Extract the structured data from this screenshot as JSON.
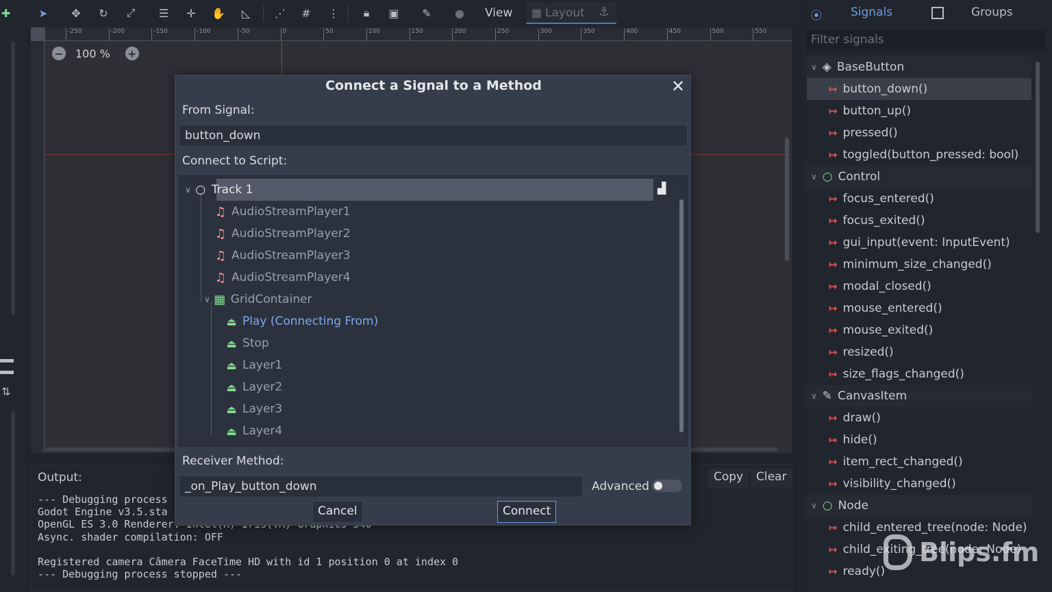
{
  "toolbar": {
    "view_label": "View",
    "layout_label": "Layout"
  },
  "viewport": {
    "zoom_label": "100 %",
    "ruler_ticks": [
      "-250",
      "-200",
      "-150",
      "-100",
      "-50",
      "0",
      "50",
      "100",
      "150",
      "200",
      "250",
      "300",
      "350",
      "400",
      "450",
      "500",
      "550"
    ]
  },
  "output": {
    "label": "Output:",
    "copy_label": "Copy",
    "clear_label": "Clear",
    "lines": [
      "--- Debugging process",
      "Godot Engine v3.5.sta",
      "OpenGL ES 3.0 Renderer: Intel(R) Iris(TM) Graphics 540",
      "Async. shader compilation: OFF",
      "",
      "Registered camera Câmera FaceTime HD with id 1 position 0 at index 0",
      "--- Debugging process stopped ---"
    ]
  },
  "dock": {
    "tab_signals": "Signals",
    "tab_groups": "Groups",
    "filter_placeholder": "Filter signals",
    "rows": [
      {
        "type": "section",
        "icon": "cube-icon",
        "label": "BaseButton"
      },
      {
        "type": "signal",
        "label": "button_down()",
        "selected": true
      },
      {
        "type": "signal",
        "label": "button_up()"
      },
      {
        "type": "signal",
        "label": "pressed()"
      },
      {
        "type": "signal",
        "label": "toggled(button_pressed: bool)"
      },
      {
        "type": "section",
        "icon": "circle-icon",
        "label": "Control"
      },
      {
        "type": "signal",
        "label": "focus_entered()"
      },
      {
        "type": "signal",
        "label": "focus_exited()"
      },
      {
        "type": "signal",
        "label": "gui_input(event: InputEvent)"
      },
      {
        "type": "signal",
        "label": "minimum_size_changed()"
      },
      {
        "type": "signal",
        "label": "modal_closed()"
      },
      {
        "type": "signal",
        "label": "mouse_entered()"
      },
      {
        "type": "signal",
        "label": "mouse_exited()"
      },
      {
        "type": "signal",
        "label": "resized()"
      },
      {
        "type": "signal",
        "label": "size_flags_changed()"
      },
      {
        "type": "section",
        "icon": "brush-icon",
        "label": "CanvasItem"
      },
      {
        "type": "signal",
        "label": "draw()"
      },
      {
        "type": "signal",
        "label": "hide()"
      },
      {
        "type": "signal",
        "label": "item_rect_changed()"
      },
      {
        "type": "signal",
        "label": "visibility_changed()"
      },
      {
        "type": "section",
        "icon": "circle-icon",
        "label": "Node"
      },
      {
        "type": "signal",
        "label": "child_entered_tree(node: Node)"
      },
      {
        "type": "signal",
        "label": "child_exiting_tree(node: Node)"
      },
      {
        "type": "signal",
        "label": "ready()"
      }
    ]
  },
  "dialog": {
    "title": "Connect a Signal to a Method",
    "from_signal_label": "From Signal:",
    "from_signal_value": "button_down",
    "connect_to_script_label": "Connect to Script:",
    "tree": [
      {
        "label": "Track 1",
        "icon": "node-circle-icon",
        "depth": 0,
        "root": true
      },
      {
        "label": "AudioStreamPlayer1",
        "icon": "audio-icon",
        "depth": 1
      },
      {
        "label": "AudioStreamPlayer2",
        "icon": "audio-icon",
        "depth": 1
      },
      {
        "label": "AudioStreamPlayer3",
        "icon": "audio-icon",
        "depth": 1
      },
      {
        "label": "AudioStreamPlayer4",
        "icon": "audio-icon",
        "depth": 1
      },
      {
        "label": "GridContainer",
        "icon": "grid-icon",
        "depth": 1,
        "expanded": true
      },
      {
        "label": "Play (Connecting From)",
        "icon": "button-icon",
        "depth": 2,
        "connecting": true
      },
      {
        "label": "Stop",
        "icon": "button-icon",
        "depth": 2
      },
      {
        "label": "Layer1",
        "icon": "button-icon",
        "depth": 2
      },
      {
        "label": "Layer2",
        "icon": "button-icon",
        "depth": 2
      },
      {
        "label": "Layer3",
        "icon": "button-icon",
        "depth": 2
      },
      {
        "label": "Layer4",
        "icon": "button-icon",
        "depth": 2
      }
    ],
    "receiver_method_label": "Receiver Method:",
    "receiver_method_value": "_on_Play_button_down",
    "advanced_label": "Advanced",
    "advanced_on": false,
    "cancel_label": "Cancel",
    "connect_label": "Connect"
  },
  "watermark": {
    "text": "Blips.fm"
  },
  "colors": {
    "accent": "#6e9cdb",
    "signal_arrow": "#e05555",
    "node_green": "#7fdc8f",
    "audio_pink": "#ff9b8b",
    "connecting_blue": "#7fa8ee"
  }
}
